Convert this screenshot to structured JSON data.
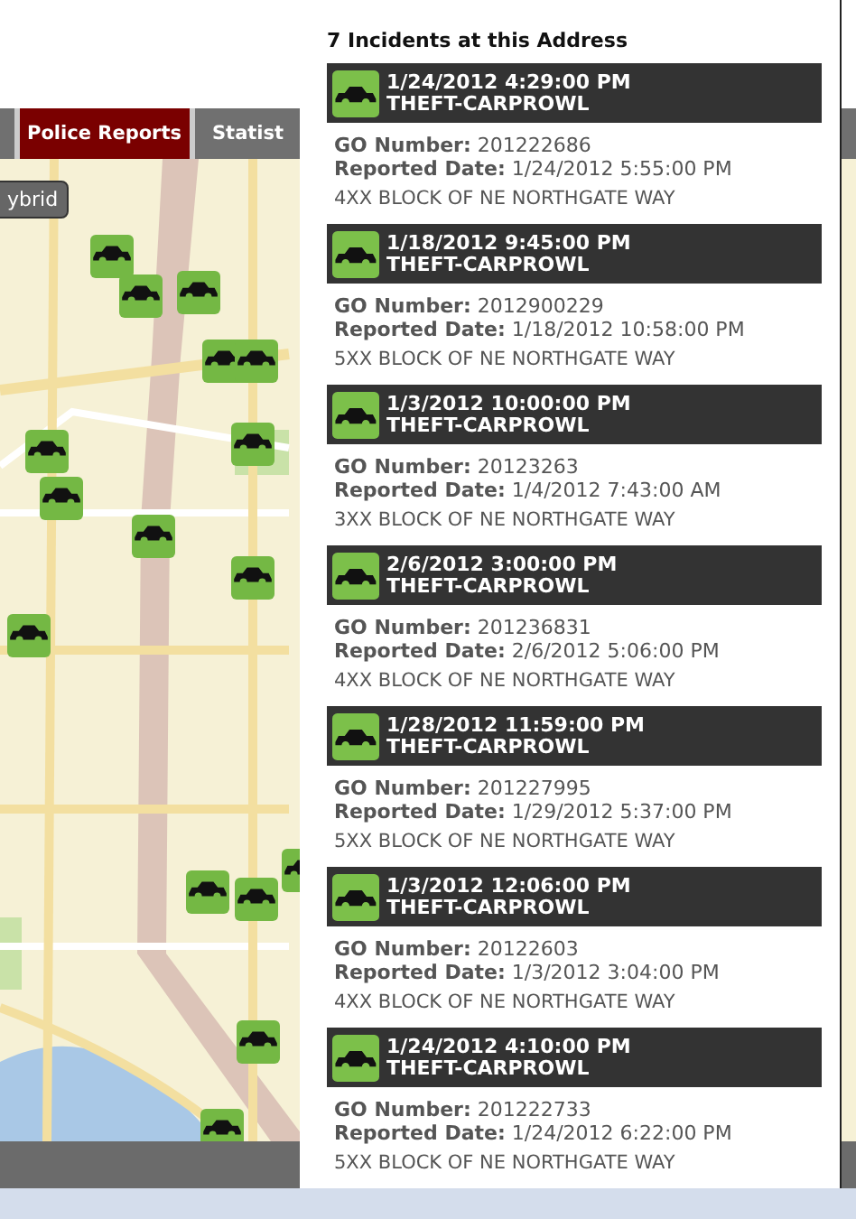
{
  "tabs": [
    {
      "label": "Police Reports",
      "selected": true
    },
    {
      "label": "Statist",
      "selected": false
    }
  ],
  "map_toggle": {
    "label": "ybrid"
  },
  "popup": {
    "title": "7 Incidents at this Address",
    "incidents": [
      {
        "datetime": "1/24/2012 4:29:00 PM",
        "type": "THEFT-CARPROWL",
        "go_line": "**GO Number:** 201222686",
        "reported_line": "**Reported Date:** 1/24/2012 5:55:00 PM",
        "address": "4XX BLOCK OF NE NORTHGATE WAY"
      },
      {
        "datetime": "1/18/2012 9:45:00 PM",
        "type": "THEFT-CARPROWL",
        "go_line": "**GO Number:** 2012900229",
        "reported_line": "**Reported Date:** 1/18/2012 10:58:00 PM",
        "address": "5XX BLOCK OF NE NORTHGATE WAY"
      },
      {
        "datetime": "1/3/2012 10:00:00 PM",
        "type": "THEFT-CARPROWL",
        "go_line": "**GO Number:** 20123263",
        "reported_line": "**Reported Date:** 1/4/2012 7:43:00 AM",
        "address": "3XX BLOCK OF NE NORTHGATE WAY"
      },
      {
        "datetime": "2/6/2012 3:00:00 PM",
        "type": "THEFT-CARPROWL",
        "go_line": "**GO Number:** 201236831",
        "reported_line": "**Reported Date:** 2/6/2012 5:06:00 PM",
        "address": "4XX BLOCK OF NE NORTHGATE WAY"
      },
      {
        "datetime": "1/28/2012 11:59:00 PM",
        "type": "THEFT-CARPROWL",
        "go_line": "**GO Number:** 201227995",
        "reported_line": "**Reported Date:** 1/29/2012 5:37:00 PM",
        "address": "5XX BLOCK OF NE NORTHGATE WAY"
      },
      {
        "datetime": "1/3/2012 12:06:00 PM",
        "type": "THEFT-CARPROWL",
        "go_line": "**GO Number:** 20122603",
        "reported_line": "**Reported Date:** 1/3/2012 3:04:00 PM",
        "address": "4XX BLOCK OF NE NORTHGATE WAY"
      },
      {
        "datetime": "1/24/2012 4:10:00 PM",
        "type": "THEFT-CARPROWL",
        "go_line": "**GO Number:** 201222733",
        "reported_line": "**Reported Date:** 1/24/2012 6:22:00 PM",
        "address": "5XX BLOCK OF NE NORTHGATE WAY"
      }
    ]
  }
}
